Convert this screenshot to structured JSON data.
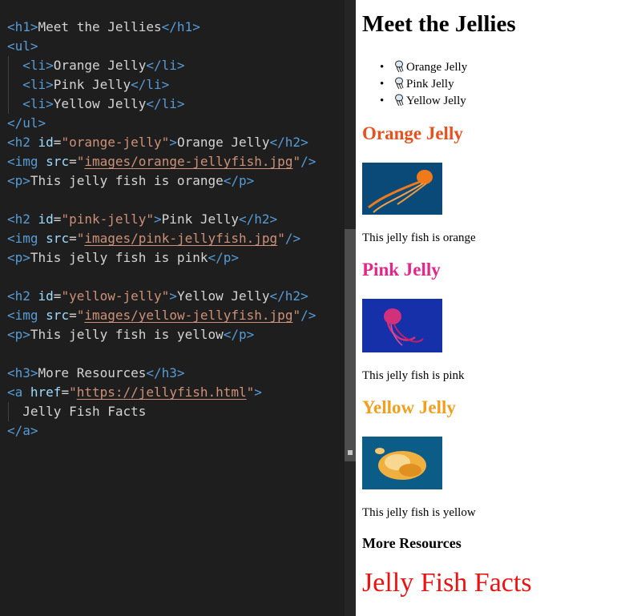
{
  "editor": {
    "lines": [
      {
        "parts": [
          {
            "c": "t",
            "v": "<h1>"
          },
          {
            "c": "",
            "v": "Meet the Jellies"
          },
          {
            "c": "t",
            "v": "</h1>"
          }
        ]
      },
      {
        "parts": [
          {
            "c": "t",
            "v": "<ul>"
          }
        ]
      },
      {
        "parts": [
          {
            "c": "",
            "v": "  "
          },
          {
            "c": "t",
            "v": "<li>"
          },
          {
            "c": "",
            "v": "Orange Jelly"
          },
          {
            "c": "t",
            "v": "</li>"
          }
        ]
      },
      {
        "parts": [
          {
            "c": "",
            "v": "  "
          },
          {
            "c": "t",
            "v": "<li>"
          },
          {
            "c": "",
            "v": "Pink Jelly"
          },
          {
            "c": "t",
            "v": "</li>"
          }
        ]
      },
      {
        "parts": [
          {
            "c": "",
            "v": "  "
          },
          {
            "c": "t",
            "v": "<li>"
          },
          {
            "c": "",
            "v": "Yellow Jelly"
          },
          {
            "c": "t",
            "v": "</li>"
          }
        ]
      },
      {
        "parts": [
          {
            "c": "t",
            "v": "</ul>"
          }
        ]
      },
      {
        "parts": [
          {
            "c": "t",
            "v": "<h2 "
          },
          {
            "c": "a",
            "v": "id"
          },
          {
            "c": "",
            "v": "="
          },
          {
            "c": "s",
            "v": "\"orange-jelly\""
          },
          {
            "c": "t",
            "v": ">"
          },
          {
            "c": "",
            "v": "Orange Jelly"
          },
          {
            "c": "t",
            "v": "</h2>"
          }
        ]
      },
      {
        "parts": [
          {
            "c": "t",
            "v": "<img "
          },
          {
            "c": "a",
            "v": "src"
          },
          {
            "c": "",
            "v": "="
          },
          {
            "c": "s",
            "v": "\""
          },
          {
            "c": "s u",
            "v": "images/orange-jellyfish.jpg"
          },
          {
            "c": "s",
            "v": "\""
          },
          {
            "c": "t",
            "v": "/>"
          }
        ]
      },
      {
        "parts": [
          {
            "c": "t",
            "v": "<p>"
          },
          {
            "c": "",
            "v": "This jelly fish is orange"
          },
          {
            "c": "t",
            "v": "</p>"
          }
        ]
      },
      {
        "parts": []
      },
      {
        "parts": [
          {
            "c": "t",
            "v": "<h2 "
          },
          {
            "c": "a",
            "v": "id"
          },
          {
            "c": "",
            "v": "="
          },
          {
            "c": "s",
            "v": "\"pink-jelly\""
          },
          {
            "c": "t",
            "v": ">"
          },
          {
            "c": "",
            "v": "Pink Jelly"
          },
          {
            "c": "t",
            "v": "</h2>"
          }
        ]
      },
      {
        "parts": [
          {
            "c": "t",
            "v": "<img "
          },
          {
            "c": "a",
            "v": "src"
          },
          {
            "c": "",
            "v": "="
          },
          {
            "c": "s",
            "v": "\""
          },
          {
            "c": "s u",
            "v": "images/pink-jellyfish.jpg"
          },
          {
            "c": "s",
            "v": "\""
          },
          {
            "c": "t",
            "v": "/>"
          }
        ]
      },
      {
        "parts": [
          {
            "c": "t",
            "v": "<p>"
          },
          {
            "c": "",
            "v": "This jelly fish is pink"
          },
          {
            "c": "t",
            "v": "</p>"
          }
        ]
      },
      {
        "parts": []
      },
      {
        "parts": [
          {
            "c": "t",
            "v": "<h2 "
          },
          {
            "c": "a",
            "v": "id"
          },
          {
            "c": "",
            "v": "="
          },
          {
            "c": "s",
            "v": "\"yellow-jelly\""
          },
          {
            "c": "t",
            "v": ">"
          },
          {
            "c": "",
            "v": "Yellow Jelly"
          },
          {
            "c": "t",
            "v": "</h2>"
          }
        ]
      },
      {
        "parts": [
          {
            "c": "t",
            "v": "<img "
          },
          {
            "c": "a",
            "v": "src"
          },
          {
            "c": "",
            "v": "="
          },
          {
            "c": "s",
            "v": "\""
          },
          {
            "c": "s u",
            "v": "images/yellow-jellyfish.jpg"
          },
          {
            "c": "s",
            "v": "\""
          },
          {
            "c": "t",
            "v": "/>"
          }
        ]
      },
      {
        "parts": [
          {
            "c": "t",
            "v": "<p>"
          },
          {
            "c": "",
            "v": "This jelly fish is yellow"
          },
          {
            "c": "t",
            "v": "</p>"
          }
        ]
      },
      {
        "parts": []
      },
      {
        "parts": [
          {
            "c": "t",
            "v": "<h3>"
          },
          {
            "c": "",
            "v": "More Resources"
          },
          {
            "c": "t",
            "v": "</h3>"
          }
        ]
      },
      {
        "parts": [
          {
            "c": "t",
            "v": "<a "
          },
          {
            "c": "a",
            "v": "href"
          },
          {
            "c": "",
            "v": "="
          },
          {
            "c": "s",
            "v": "\""
          },
          {
            "c": "s u",
            "v": "https://jellyfish.html"
          },
          {
            "c": "s",
            "v": "\""
          },
          {
            "c": "t",
            "v": ">"
          }
        ]
      },
      {
        "parts": [
          {
            "c": "",
            "v": "  Jelly Fish Facts"
          }
        ]
      },
      {
        "parts": [
          {
            "c": "t",
            "v": "</a>"
          }
        ]
      }
    ]
  },
  "preview": {
    "title": "Meet the Jellies",
    "list": [
      "Orange Jelly",
      "Pink Jelly",
      "Yellow Jelly"
    ],
    "sections": [
      {
        "heading": "Orange Jelly",
        "color": "#e8501e",
        "caption": "This jelly fish is orange",
        "img_bg": "#0a4a78",
        "jelly": "#f07a1a"
      },
      {
        "heading": "Pink Jelly",
        "color": "#e0278a",
        "caption": "This jelly fish is pink",
        "img_bg": "#1530a8",
        "jelly": "#d2307a"
      },
      {
        "heading": "Yellow Jelly",
        "color": "#f0a020",
        "caption": "This jelly fish is yellow",
        "img_bg": "#0c5c88",
        "jelly": "#f0b040"
      }
    ],
    "more_heading": "More Resources",
    "link_text": "Jelly Fish Facts",
    "link_color": "#ee1111"
  }
}
